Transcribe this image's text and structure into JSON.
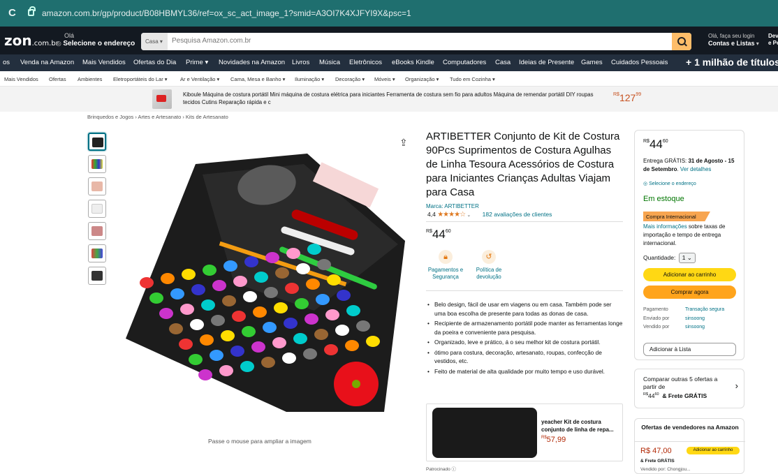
{
  "browser": {
    "url": "amazon.com.br/gp/product/B08HBMYL36/ref=ox_sc_act_image_1?smid=A3OI7K4XJFYI9X&psc=1"
  },
  "header": {
    "logo": "zon",
    "logo_suffix": ".com.br",
    "address_hello": "Olá",
    "address_cta": "Selecione o endereço",
    "search_category": "Casa",
    "search_placeholder": "Pesquisa Amazon.com.br",
    "account_hello": "Olá, faça seu login",
    "account_lists": "Contas e Listas",
    "returns_top": "Devo",
    "returns_bottom": "e Pe"
  },
  "nav": {
    "items": [
      "os",
      "Venda na Amazon",
      "Mais Vendidos",
      "Ofertas do Dia",
      "Prime",
      "Novidades na Amazon",
      "Livros",
      "Música",
      "Eletrônicos",
      "eBooks Kindle",
      "Computadores",
      "Casa",
      "Ideias de Presente",
      "Games",
      "Cuidados Pessoais"
    ],
    "promo": "+ 1 milhão de títulos"
  },
  "subnav": {
    "items": [
      "Mais Vendidos",
      "Ofertas",
      "Ambientes",
      "Eletroportáteis do Lar",
      "Ar e Ventilação",
      "Cama, Mesa e Banho",
      "Iluminação",
      "Decoração",
      "Móveis",
      "Organização",
      "Tudo em Cozinha"
    ]
  },
  "banner": {
    "text": "Kiboule Máquina de costura portátil Mini máquina de costura elétrica para iniciantes Ferramenta de costura sem fio para adultos Máquina de remendar portátil DIY roupas tecidos Cutins Reparação rápida e c",
    "currency": "R$",
    "price": "127",
    "cents": "99"
  },
  "breadcrumb": "Brinquedos e Jogos › Artes e Artesanato › Kits de Artesanato",
  "gallery": {
    "hint": "Passe o mouse para ampliar a imagem"
  },
  "product": {
    "title": "ARTIBETTER Conjunto de Kit de Costura 90Pcs Suprimentos de Costura Agulhas de Linha Tesoura Acessórios de Costura para Iniciantes Crianças Adultas Viajam para Casa",
    "brand": "Marca: ARTIBETTER",
    "rating_value": "4,4",
    "stars": "★★★★☆",
    "rating_count": "182 avaliações de clientes",
    "currency": "R$",
    "price": "44",
    "cents": "60",
    "services": [
      {
        "line1": "Pagamentos e",
        "line2": "Segurança"
      },
      {
        "line1": "Política de",
        "line2": "devolução"
      }
    ],
    "bullets": [
      "Belo design, fácil de usar em viagens ou em casa. Também pode ser uma boa escolha de presente para todas as donas de casa.",
      "Recipiente de armazenamento portátil pode manter as ferramentas longe da poeira e conveniente para pesquisa.",
      "Organizado, leve e prático, á o seu melhor kit de costura portátil.",
      "ótimo para costura, decoração, artesanato, roupas, confecção de vestidos, etc.",
      "Feito de material de alta qualidade por muito tempo e uso durável."
    ]
  },
  "sponsored": {
    "title": "yeacher Kit de costura conjunto de linha de repa...",
    "currency": "R$",
    "price": "57,99",
    "label": "Patrocinado ⓘ"
  },
  "buybox": {
    "currency": "R$",
    "price": "44",
    "cents": "60",
    "delivery_pre": "Entrega GRÁTIS: ",
    "delivery_dates": "31 de Agosto - 15 de Setembro",
    "delivery_link": "Ver detalhes",
    "select_address": "Selecione o endereço",
    "stock": "Em estoque",
    "intl_badge": "Compra Internacional",
    "more_info_link": "Mais informações",
    "more_info_text": " sobre taxas de importação e tempo de entrega internacional.",
    "qty_label": "Quantidade:",
    "qty_value": "1",
    "add_to_cart": "Adicionar ao carrinho",
    "buy_now": "Comprar agora",
    "payment_label": "Pagamento",
    "payment_value": "Transação segura",
    "shipped_label": "Enviado por",
    "shipped_value": "sinsoong",
    "sold_label": "Vendido por",
    "sold_value": "sinsoong",
    "add_list": "Adicionar à Lista"
  },
  "compare": {
    "line1": "Comparar outras 5 ofertas a partir de",
    "currency": "R$",
    "price": "44",
    "cents": "60",
    "free": "& Frete GRÁTIS"
  },
  "offers": {
    "header": "Ofertas de vendedores na Amazon",
    "price": "R$ 47,00",
    "button": "Adicionar ao carrinho",
    "free": "& Frete GRÁTIS",
    "vendor": "Vendido por: Chongjou..."
  },
  "colors": {
    "accent_teal": "#007185",
    "cart_yellow": "#ffd814",
    "buy_orange": "#ffa41c",
    "price_red": "#b12704",
    "header_dark": "#131921",
    "nav_dark": "#232f3e"
  }
}
